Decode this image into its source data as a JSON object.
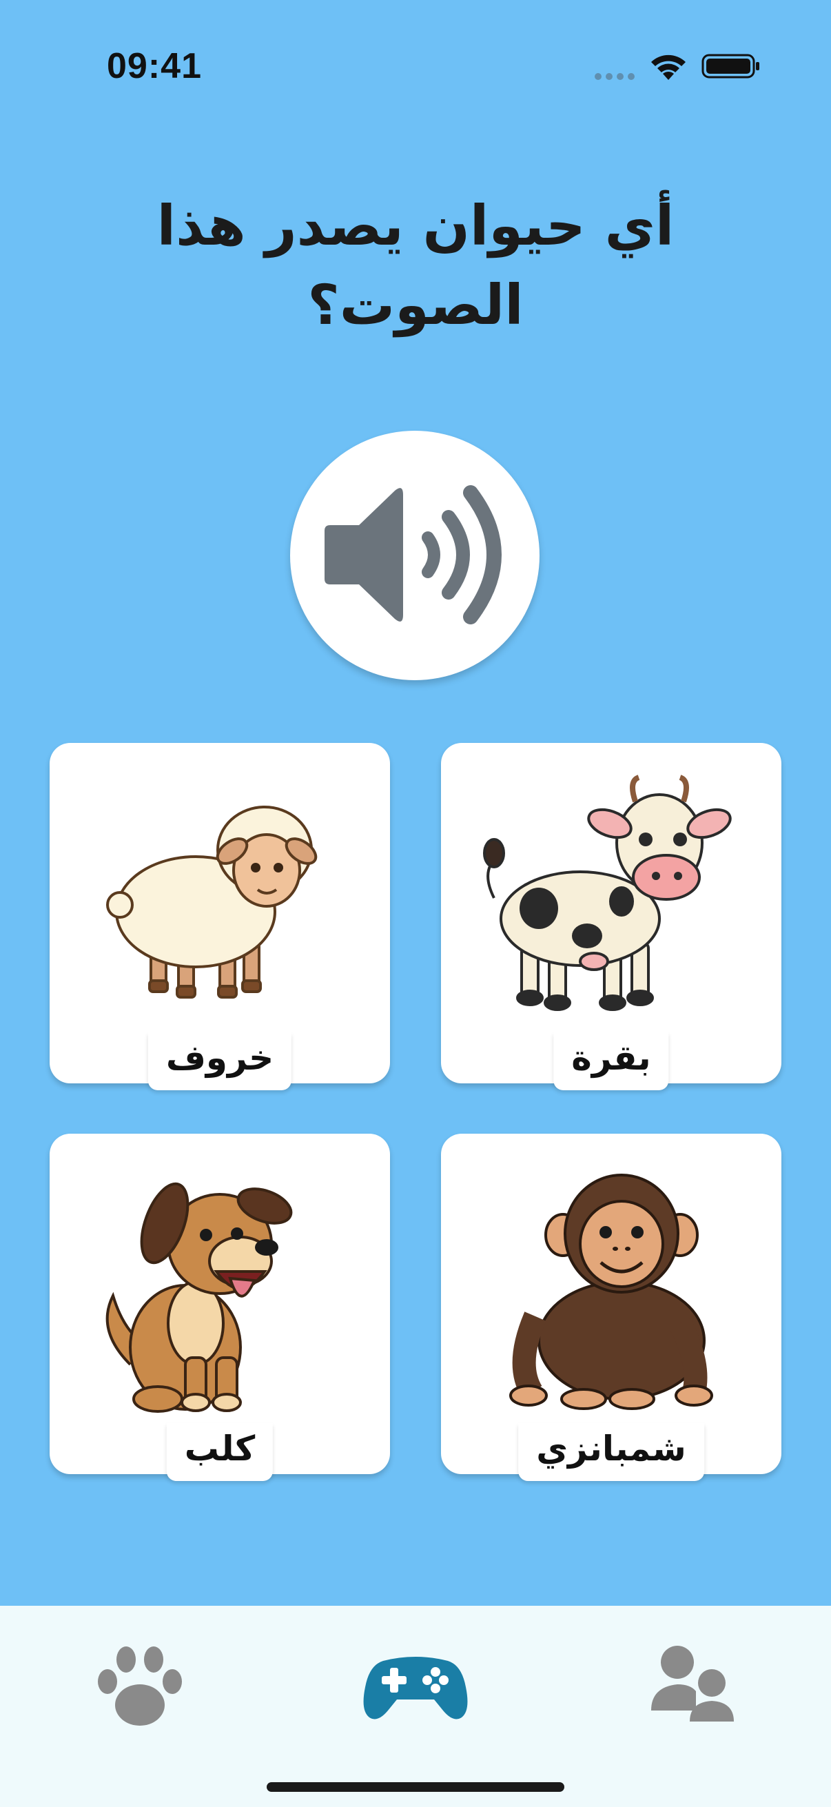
{
  "status_bar": {
    "time": "09:41",
    "icons": [
      "cellular-dots-icon",
      "wifi-icon",
      "battery-icon"
    ]
  },
  "question": {
    "title": "أي حيوان يصدر هذا الصوت؟"
  },
  "sound_button": {
    "icon": "speaker-volume-icon"
  },
  "answers": [
    {
      "label": "خروف",
      "icon": "sheep-illustration"
    },
    {
      "label": "بقرة",
      "icon": "cow-illustration"
    },
    {
      "label": "كلب",
      "icon": "dog-illustration"
    },
    {
      "label": "شمبانزي",
      "icon": "chimpanzee-illustration"
    }
  ],
  "tab_bar": {
    "items": [
      {
        "icon": "paw-icon",
        "active": false
      },
      {
        "icon": "gamepad-icon",
        "active": true
      },
      {
        "icon": "users-icon",
        "active": false
      }
    ]
  },
  "colors": {
    "background": "#6ec0f6",
    "card": "#ffffff",
    "tab_bar": "#effafc",
    "tab_active": "#1a7ea6",
    "tab_inactive": "#8a8a8a",
    "speaker_icon": "#6b747c"
  }
}
